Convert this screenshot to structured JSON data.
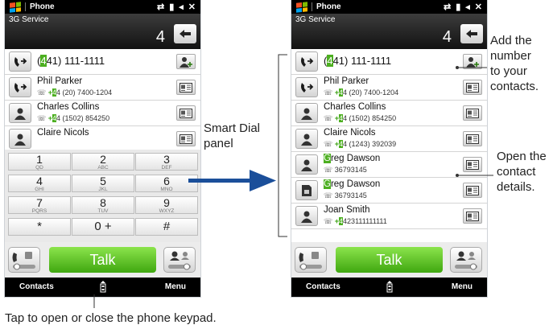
{
  "status": {
    "app_title": "Phone"
  },
  "header": {
    "service": "3G Service",
    "digit": "4"
  },
  "screen1": {
    "rows": [
      {
        "type": "number",
        "pre": "",
        "hl": "4",
        "post": "41) 111-1111",
        "num_pre": "",
        "num_hl": "",
        "num_post": ""
      },
      {
        "type": "contact",
        "pre": "",
        "hl": "",
        "post": "Phil Parker",
        "num_pre": "+",
        "num_hl": "4",
        "num_post": "4 (20) 7400-1204"
      },
      {
        "type": "contact",
        "pre": "",
        "hl": "",
        "post": "Charles Collins",
        "num_pre": "+",
        "num_hl": "4",
        "num_post": "4 (1502) 854250"
      },
      {
        "type": "contact",
        "pre": "",
        "hl": "",
        "post": "Claire Nicols",
        "num_pre": "",
        "num_hl": "",
        "num_post": ""
      }
    ],
    "keys": [
      {
        "digit": "1",
        "letters": "QD"
      },
      {
        "digit": "2",
        "letters": "ABC"
      },
      {
        "digit": "3",
        "letters": "DEF"
      },
      {
        "digit": "4",
        "letters": "GHI"
      },
      {
        "digit": "5",
        "letters": "JKL"
      },
      {
        "digit": "6",
        "letters": "MNO"
      },
      {
        "digit": "7",
        "letters": "PQRS"
      },
      {
        "digit": "8",
        "letters": "TUV"
      },
      {
        "digit": "9",
        "letters": "WXYZ"
      },
      {
        "digit": "*",
        "letters": ""
      },
      {
        "digit": "0 +",
        "letters": ""
      },
      {
        "digit": "#",
        "letters": ""
      }
    ]
  },
  "screen2": {
    "rows": [
      {
        "type": "number",
        "pre": "",
        "hl": "4",
        "post": "41) 111-1111",
        "num_pre": "",
        "num_hl": "",
        "num_post": ""
      },
      {
        "type": "contact",
        "pre": "",
        "hl": "",
        "post": "Phil Parker",
        "num_pre": "+",
        "num_hl": "4",
        "num_post": "4 (20) 7400-1204"
      },
      {
        "type": "contact",
        "pre": "",
        "hl": "",
        "post": "Charles Collins",
        "num_pre": "+",
        "num_hl": "4",
        "num_post": "4 (1502) 854250"
      },
      {
        "type": "contact",
        "pre": "",
        "hl": "",
        "post": "Claire Nicols",
        "num_pre": "+",
        "num_hl": "4",
        "num_post": "4 (1243) 392039"
      },
      {
        "type": "contact",
        "pre": "",
        "hl": "G",
        "post": "reg Dawson",
        "num_pre": "",
        "num_hl": "",
        "num_post": "36793145"
      },
      {
        "type": "sim",
        "pre": "",
        "hl": "G",
        "post": "reg Dawson",
        "num_pre": "",
        "num_hl": "",
        "num_post": "36793145"
      },
      {
        "type": "contact",
        "pre": "",
        "hl": "",
        "post": "Joan Smith",
        "num_pre": "+",
        "num_hl": "4",
        "num_post": "423111111111"
      }
    ]
  },
  "talk_label": "Talk",
  "softkeys": {
    "left": "Contacts",
    "right": "Menu"
  },
  "callouts": {
    "smart_dial": [
      "Smart Dial",
      "panel"
    ],
    "add_number": [
      "Add the",
      "number",
      "to your",
      "contacts."
    ],
    "open_contact": [
      "Open the",
      "contact",
      "details."
    ],
    "keypad_tip": "Tap to open or close the phone keypad."
  },
  "colors": {
    "highlight": "#4caf20",
    "talk": "#5cc225",
    "arrow": "#1b4f9a"
  }
}
